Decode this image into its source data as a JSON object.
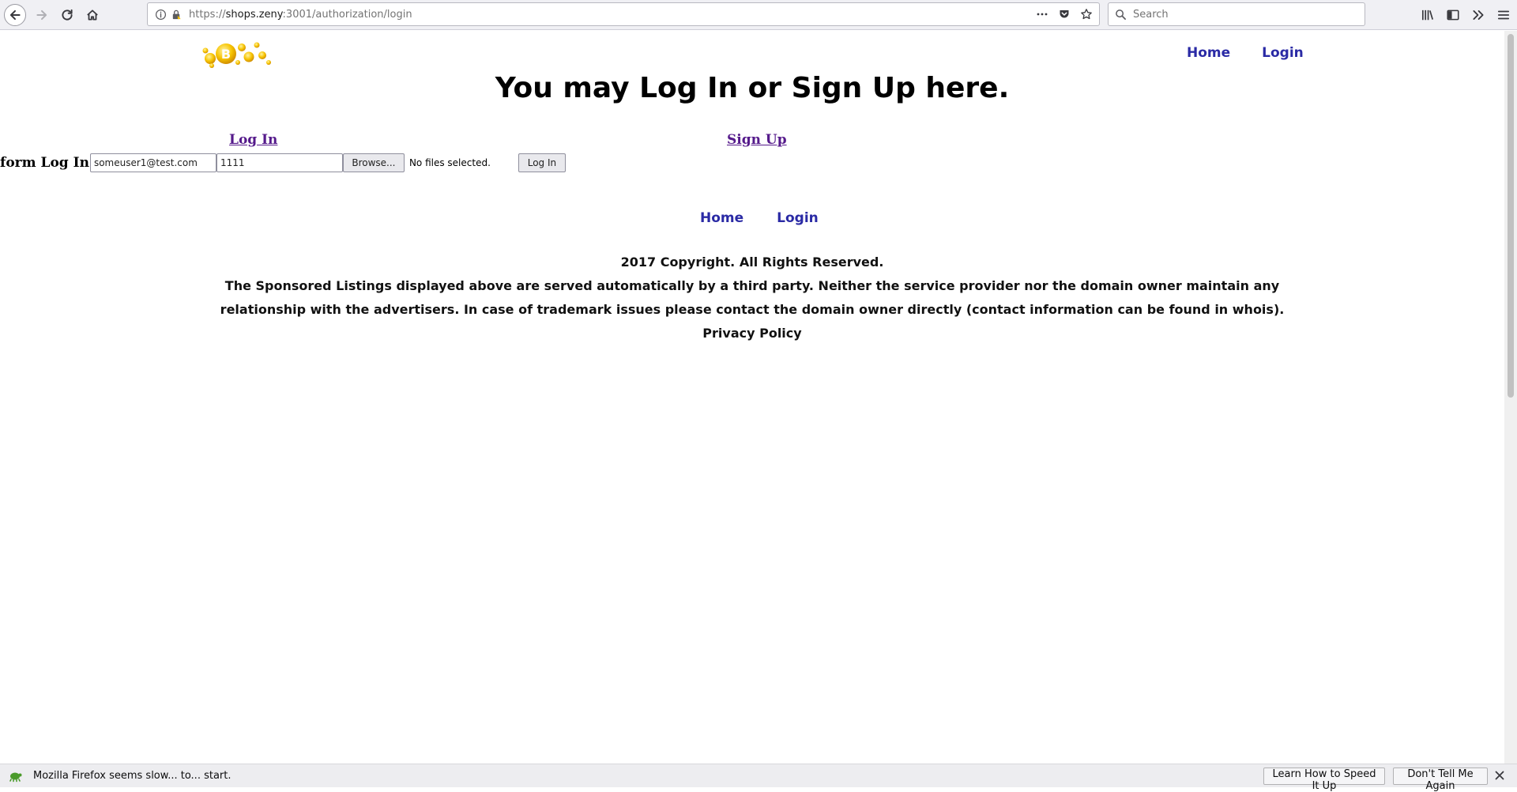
{
  "browser": {
    "url_scheme": "https://",
    "url_host": "shops.zeny",
    "url_path": ":3001/authorization/login",
    "search_placeholder": "Search"
  },
  "header": {
    "nav": [
      {
        "label": "Home"
      },
      {
        "label": "Login"
      }
    ],
    "headline": "You may Log In or Sign Up here."
  },
  "tabs": {
    "login": "Log In",
    "signup": "Sign Up"
  },
  "form": {
    "label": "form Log In",
    "email_value": "someuser1@test.com",
    "password_value": "1111",
    "browse_label": "Browse...",
    "file_status": "No files selected.",
    "submit_label": "Log In"
  },
  "bottom_nav": [
    {
      "label": "Home"
    },
    {
      "label": "Login"
    }
  ],
  "footer": {
    "copyright": "2017 Copyright. All Rights Reserved.",
    "disclaimer": "The Sponsored Listings displayed above are served automatically by a third party. Neither the service provider nor the domain owner maintain any relationship with the advertisers. In case of trademark issues please contact the domain owner directly (contact information can be found in whois).",
    "privacy": "Privacy Policy"
  },
  "notification": {
    "message": "Mozilla Firefox seems slow... to... start.",
    "learn_button": "Learn How to Speed It Up",
    "dismiss_button": "Don't Tell Me Again"
  },
  "colors": {
    "nav_link": "#2a2aa5",
    "visited_link": "#551a8b",
    "logo_gold": "#f5b800"
  },
  "icons": {
    "back": "back-arrow-icon",
    "forward": "forward-arrow-icon",
    "reload": "reload-icon",
    "home": "home-icon",
    "site_info": "info-icon",
    "insecure": "insecure-lock-icon",
    "page_actions": "more-dots-icon",
    "pocket": "pocket-icon",
    "bookmark": "star-icon",
    "search": "search-icon",
    "library": "library-icon",
    "sidebar": "sidebar-icon",
    "overflow": "overflow-chevron-icon",
    "menu": "hamburger-menu-icon",
    "notification": "turtle-icon",
    "close": "close-icon"
  }
}
